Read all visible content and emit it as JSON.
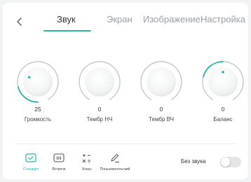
{
  "tabs": [
    {
      "label": "Звук",
      "active": true
    },
    {
      "label": "Экран",
      "active": false
    },
    {
      "label": "Изображение",
      "active": false
    },
    {
      "label": "Настройка",
      "active": false
    }
  ],
  "knobs": [
    {
      "label": "Громкость",
      "value": "25"
    },
    {
      "label": "Тембр НЧ",
      "value": "0"
    },
    {
      "label": "Тембр ВЧ",
      "value": "0"
    },
    {
      "label": "Баланс",
      "value": "0"
    }
  ],
  "modes": [
    {
      "label": "Стандарт",
      "icon": "check-screen-icon",
      "active": true
    },
    {
      "label": "Встреча",
      "icon": "meeting-icon",
      "active": false
    },
    {
      "label": "Класс",
      "icon": "math-symbols-icon",
      "active": false
    },
    {
      "label": "Пользовательский",
      "icon": "pen-icon",
      "active": false
    }
  ],
  "mute": {
    "label": "Без звука",
    "on": false
  },
  "colors": {
    "accent": "#28b4a4",
    "track": "#c4c7ca",
    "background": "#f1f3f4"
  }
}
